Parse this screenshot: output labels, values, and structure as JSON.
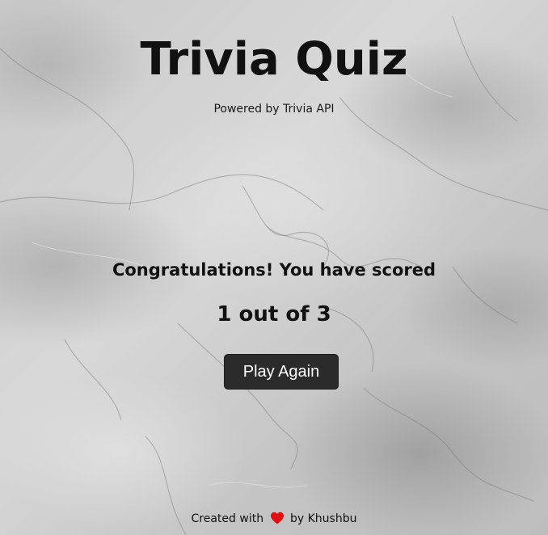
{
  "header": {
    "title": "Trivia Quiz",
    "subtitle": "Powered by Trivia API"
  },
  "result": {
    "message": "Congratulations! You have scored",
    "score_text": "1 out of 3",
    "score": 1,
    "total": 3
  },
  "actions": {
    "play_again_label": "Play Again"
  },
  "footer": {
    "prefix": "Created with",
    "icon": "heart-icon",
    "suffix": "by Khushbu"
  },
  "colors": {
    "button_bg": "#2b2b2b",
    "button_text": "#ffffff",
    "heart": "#e01010",
    "text": "#111111"
  }
}
